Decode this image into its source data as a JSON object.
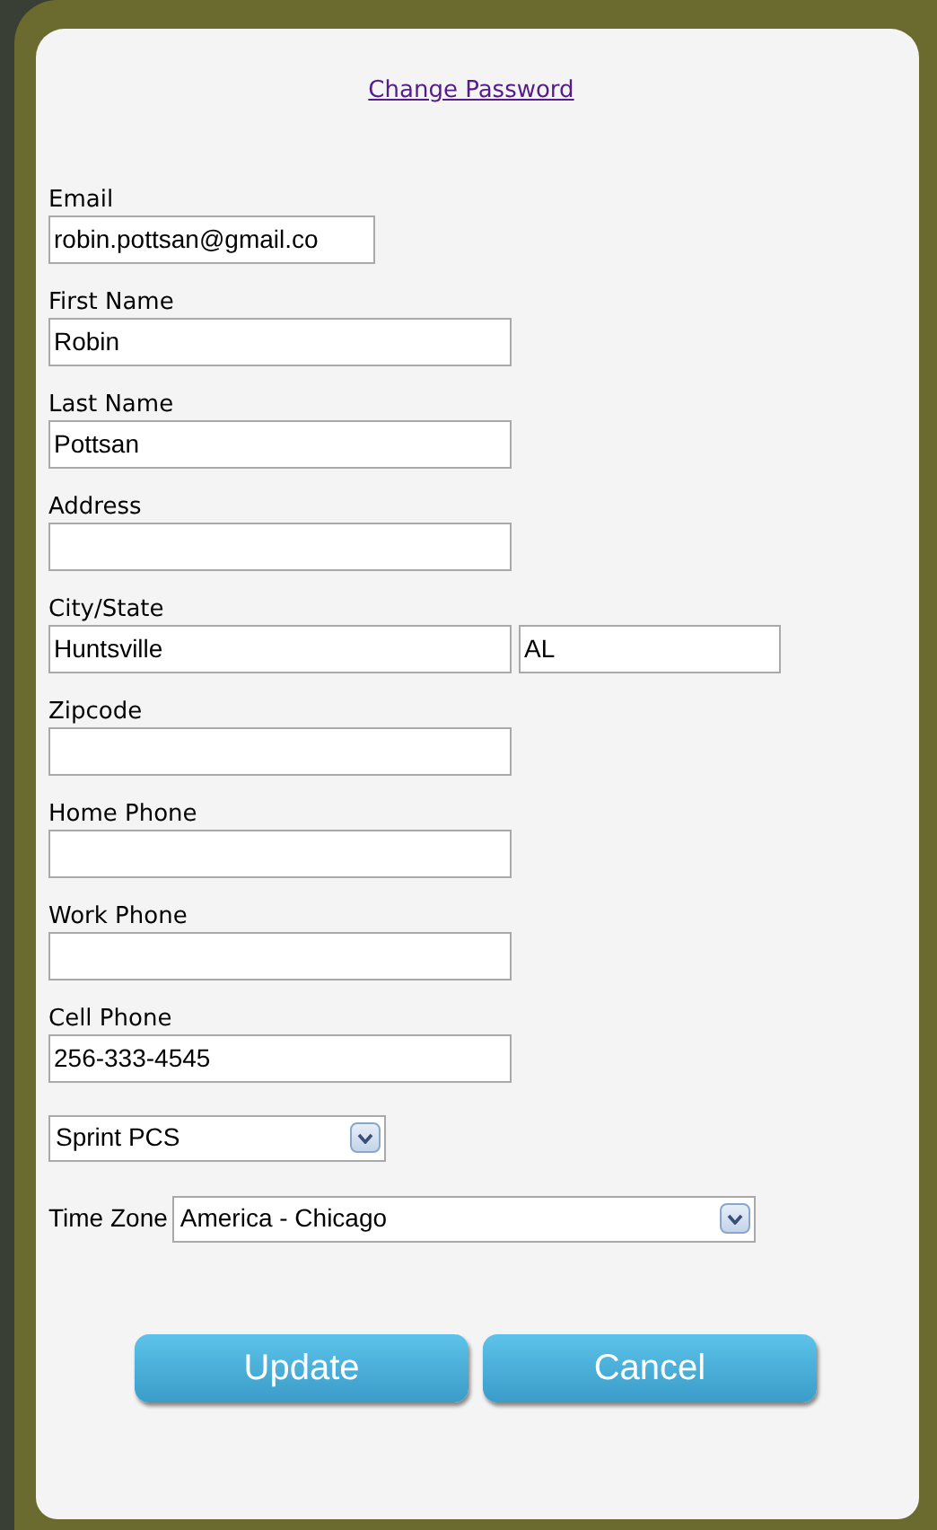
{
  "change_password_link": "Change Password",
  "fields": [
    {
      "label": "Email",
      "value": "robin.pottsan@gmail.co"
    },
    {
      "label": "First Name",
      "value": "Robin"
    },
    {
      "label": "Last Name",
      "value": "Pottsan"
    },
    {
      "label": "Address"
    },
    {
      "label": "City/State",
      "value": "Huntsville",
      "state": "AL"
    },
    {
      "label": "Zipcode"
    },
    {
      "label": "Home Phone"
    },
    {
      "label": "Work Phone"
    },
    {
      "label": "Cell Phone",
      "value": "256-333-4545"
    }
  ],
  "carrier_select": {
    "value": "Sprint PCS"
  },
  "time_zone": {
    "label": "Time Zone",
    "value": "America - Chicago"
  },
  "buttons": [
    "Update",
    "Cancel"
  ]
}
